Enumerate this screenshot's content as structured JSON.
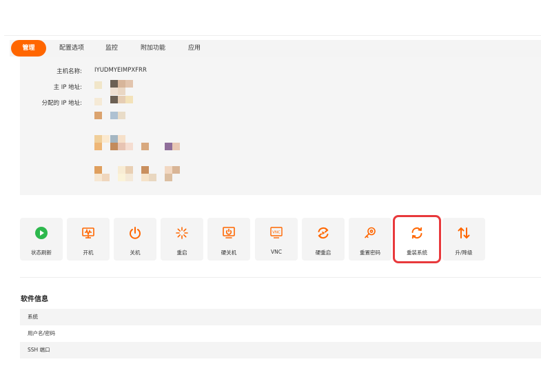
{
  "tabs": [
    {
      "label": "管理",
      "active": true
    },
    {
      "label": "配置选项",
      "active": false
    },
    {
      "label": "监控",
      "active": false
    },
    {
      "label": "附加功能",
      "active": false
    },
    {
      "label": "应用",
      "active": false
    }
  ],
  "info": {
    "hostname_label": "主机名称:",
    "hostname_value": "IYUDMYEIMPXFRR",
    "main_ip_label": "主 IP 地址:",
    "assigned_ip_label": "分配的 IP 地址:"
  },
  "actions": [
    {
      "label": "状态刷新",
      "icon": "play-circle-icon"
    },
    {
      "label": "开机",
      "icon": "power-on-monitor-icon"
    },
    {
      "label": "关机",
      "icon": "power-icon"
    },
    {
      "label": "重启",
      "icon": "spinner-icon"
    },
    {
      "label": "硬关机",
      "icon": "monitor-power-icon"
    },
    {
      "label": "VNC",
      "icon": "vnc-icon"
    },
    {
      "label": "硬重启",
      "icon": "hard-restart-icon"
    },
    {
      "label": "重置密码",
      "icon": "key-icon"
    },
    {
      "label": "重装系统",
      "icon": "refresh-icon"
    },
    {
      "label": "升/降级",
      "icon": "up-down-arrows-icon"
    }
  ],
  "software": {
    "title": "软件信息",
    "rows": [
      "系统",
      "用户名/密码",
      "SSH 端口"
    ]
  },
  "colors": {
    "accent": "#ff6600",
    "highlight": "#e8393c",
    "play": "#2db84d"
  }
}
